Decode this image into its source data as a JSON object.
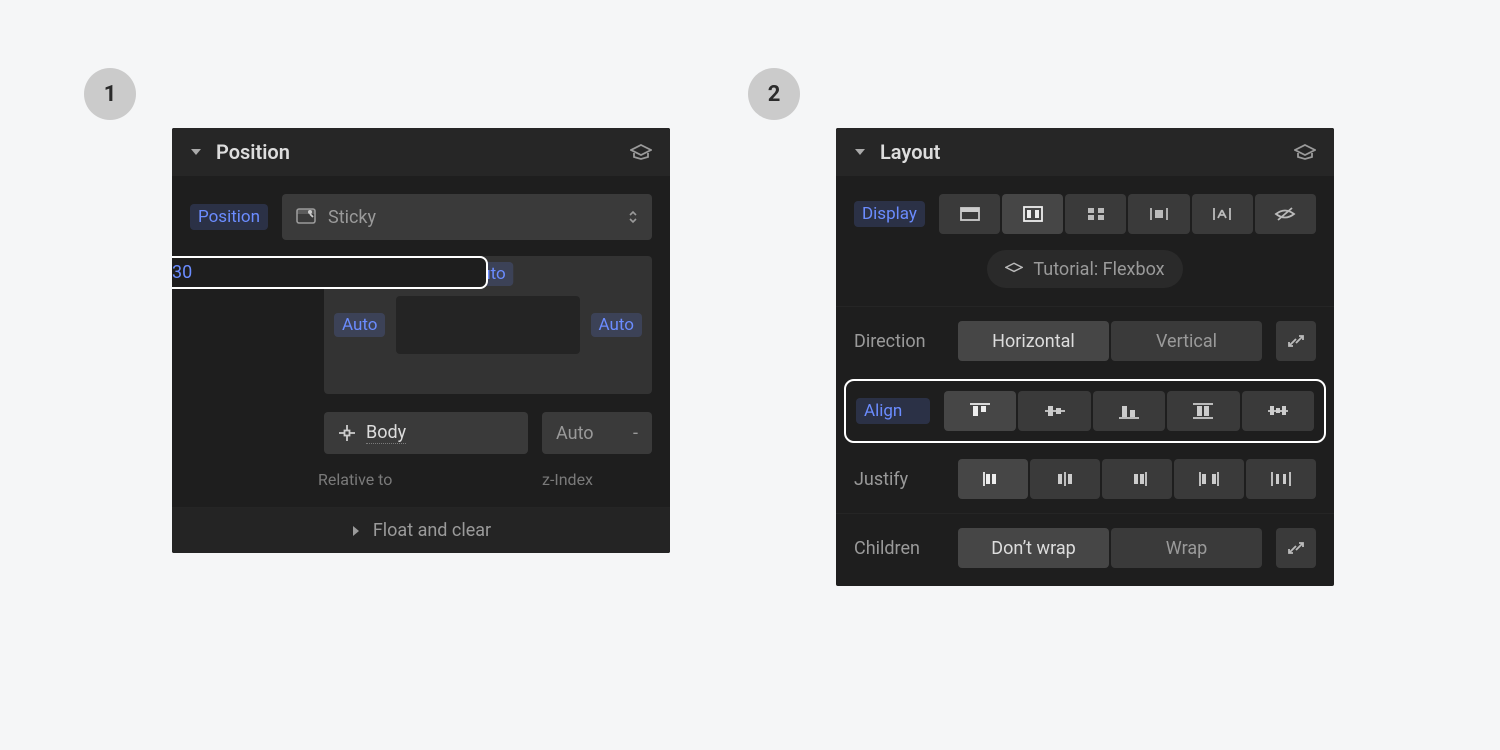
{
  "steps": {
    "one": "1",
    "two": "2"
  },
  "position_panel": {
    "title": "Position",
    "field_label": "Position",
    "dropdown_value": "Sticky",
    "offsets": {
      "top": "Auto",
      "left": "Auto",
      "right": "Auto",
      "bottom": "30"
    },
    "relative_to_target": "Body",
    "relative_to_caption": "Relative to",
    "zindex_value": "Auto",
    "zindex_dash": "-",
    "zindex_caption": "z-Index",
    "footer": "Float and clear"
  },
  "layout_panel": {
    "title": "Layout",
    "display_label": "Display",
    "tutorial": "Tutorial: Flexbox",
    "direction_label": "Direction",
    "direction_options": [
      "Horizontal",
      "Vertical"
    ],
    "direction_selected": 0,
    "align_label": "Align",
    "justify_label": "Justify",
    "children_label": "Children",
    "children_options": [
      "Don’t wrap",
      "Wrap"
    ],
    "children_selected": 0
  }
}
